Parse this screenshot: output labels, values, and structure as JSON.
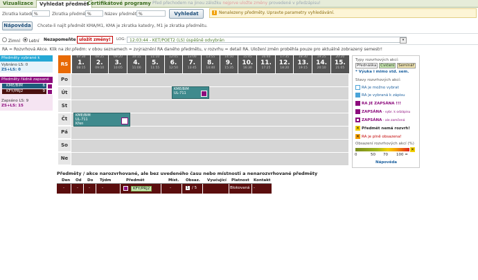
{
  "tabs": [
    {
      "label": "Vizualizace"
    },
    {
      "label": "Vyhledat předmět"
    },
    {
      "label": "Certifikátové programy"
    }
  ],
  "top_hint": {
    "before": "Před přechodem na jinou záložku ",
    "red": "nejprve uložte změny",
    "after": " provedené v předzápisu!"
  },
  "search": {
    "katedra_label": "Zkratka katedry",
    "katedra_value": "%",
    "predmet_label": "Zkratka předmětu",
    "predmet_value": "%",
    "nazev_label": "Název předmětu",
    "nazev_value": "%",
    "search_button": "Vyhledat",
    "help_button": "Nápověda",
    "help_text": "Chcete-li najít předmět KMA/M1, KMA je zkratka katedry, M1 je zkratka předmětu."
  },
  "warning": {
    "text": "Nenalezeny předměty. Upravte parametry vyhledávání."
  },
  "semester": {
    "winter": "Zimní",
    "summer": "Letní",
    "nezapomente": "Nezapomeňte",
    "save_label": "uložit změny!",
    "log_label": "LOG:",
    "log_text": "12:03:44 - KET/POET2 (LS) úspěšně odvybrán"
  },
  "legend_line": "RA = Rozvrhová Akce. Klik na zkr.předm: v obou seznamech = zvýraznění RA daného předmětu, v rozvrhu = detail RA. Uložení změn proběhla pouze pro aktuálně zobrazený semestr!",
  "left_panel": {
    "selected_head": "Předměty vybrané k zápisu",
    "selected_ls": "Vybráno LS: 0",
    "selected_zs": "ZS+LS: 0",
    "enrolled_head": "Předměty řádně zapsané",
    "enrolled": [
      {
        "code": "KME/BIM",
        "credits": "6"
      },
      {
        "code": "KFY/PRJ2",
        "credits": "9"
      }
    ],
    "enrolled_ls": "Zapsáno LS: 9",
    "enrolled_zs": "ZS+LS: 15"
  },
  "timetable": {
    "rs_label": "RS",
    "days": [
      "Po",
      "Út",
      "St",
      "Čt",
      "Pá",
      "So",
      "Ne"
    ],
    "hours": [
      {
        "n": "1.",
        "from": "07:30",
        "to": "08:15"
      },
      {
        "n": "2.",
        "from": "08:25",
        "to": "09:10"
      },
      {
        "n": "3.",
        "from": "09:20",
        "to": "10:05"
      },
      {
        "n": "4.",
        "from": "10:15",
        "to": "11:00"
      },
      {
        "n": "5.",
        "from": "11:10",
        "to": "11:55"
      },
      {
        "n": "6.",
        "from": "12:05",
        "to": "12:50"
      },
      {
        "n": "7.",
        "from": "13:00",
        "to": "13:45"
      },
      {
        "n": "8.",
        "from": "13:55",
        "to": "14:40"
      },
      {
        "n": "9.",
        "from": "14:50",
        "to": "15:35"
      },
      {
        "n": "10.",
        "from": "15:45",
        "to": "16:30"
      },
      {
        "n": "11.",
        "from": "16:40",
        "to": "17:25"
      },
      {
        "n": "12.",
        "from": "17:35",
        "to": "18:20"
      },
      {
        "n": "13.",
        "from": "18:30",
        "to": "19:15"
      },
      {
        "n": "14.",
        "from": "19:25",
        "to": "20:10"
      },
      {
        "n": "15.",
        "from": "20:20",
        "to": "21:05"
      }
    ],
    "activities": [
      {
        "code": "KME/BIM",
        "room": "UL-711",
        "teacher": ""
      },
      {
        "code": "KME/BIM",
        "room": "UL-711",
        "teacher": "Křen"
      }
    ]
  },
  "right_legend": {
    "types_label": "Typy rozvrhových akcí:",
    "types": [
      "Přednáška",
      "Cvičení",
      "Seminář"
    ],
    "outside": "* Výuka i mimo std. sem.",
    "states_label": "Stavy rozvrhových akcí:",
    "states": [
      {
        "bold": "",
        "text": "RA je možno vybrat"
      },
      {
        "bold": "",
        "text": "RA je vybraná k zápisu"
      },
      {
        "bold": "RA JE ZAPSÁNA !!!",
        "text": ""
      },
      {
        "bold": "ZAPSÁNA",
        "text": " - vybr. k odzápisu"
      },
      {
        "bold": "ZAPSÁNA",
        "text": " - ale zamčená"
      },
      {
        "bold": "Předmět nemá rozvrh!",
        "text": ""
      },
      {
        "bold": "",
        "text": "RA je plně obsazena!"
      }
    ],
    "occupancy_label": "Obsazení rozvrhových akcí (%)",
    "occupancy_ticks": [
      "0",
      "50",
      "70",
      "100 ="
    ],
    "help": "Nápověda",
    "colors": {
      "free": "#ffffff",
      "selected": "#4aa3d8",
      "enrolled": "#8c0b7c",
      "unenroll": "#8c0b7c",
      "locked": "#8c0b7c",
      "norozvrh": "#f4d000",
      "full": "#f4a000"
    }
  },
  "bottom": {
    "title": "Předměty / akce narozvrhované, ale bez uvedeného času nebo místnosti a nenarozvrhované předměty",
    "headers": [
      "Den",
      "Od",
      "Do",
      "Týdm",
      "Předmět",
      "Míst.",
      "Obsaz.",
      "Vyučující",
      "Platnost",
      "Kontakt"
    ],
    "row": {
      "den": "-",
      "od": "-",
      "do": "-",
      "tydm": "-",
      "predmet": "KFY/PRJ2",
      "mist": "-",
      "obsaz_badge": "1",
      "obsaz_rest": "/ 5",
      "vyucujici": "",
      "platnost": "Blokovaná",
      "kontakt": "-"
    }
  }
}
